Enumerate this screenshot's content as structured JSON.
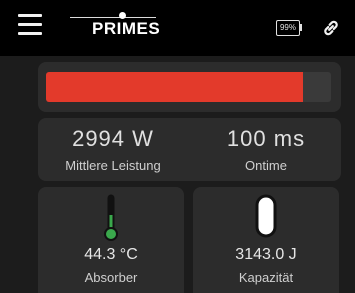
{
  "header": {
    "logo_text": "PRIMES",
    "battery_text": "99%"
  },
  "progress": {
    "fill_fraction": 0.9,
    "fill_color": "#e33a2b"
  },
  "stats": {
    "power_value": "2994 W",
    "power_label": "Mittlere Leistung",
    "ontime_value": "100 ms",
    "ontime_label": "Ontime"
  },
  "tiles": {
    "absorber_value": "44.3 °C",
    "absorber_label": "Absorber",
    "capacity_value": "3143.0 J",
    "capacity_label": "Kapazität"
  },
  "icons": {
    "menu": "menu-icon",
    "link": "link-icon",
    "battery": "battery-icon",
    "thermometer": "thermometer-icon",
    "capacity": "capacity-icon"
  }
}
